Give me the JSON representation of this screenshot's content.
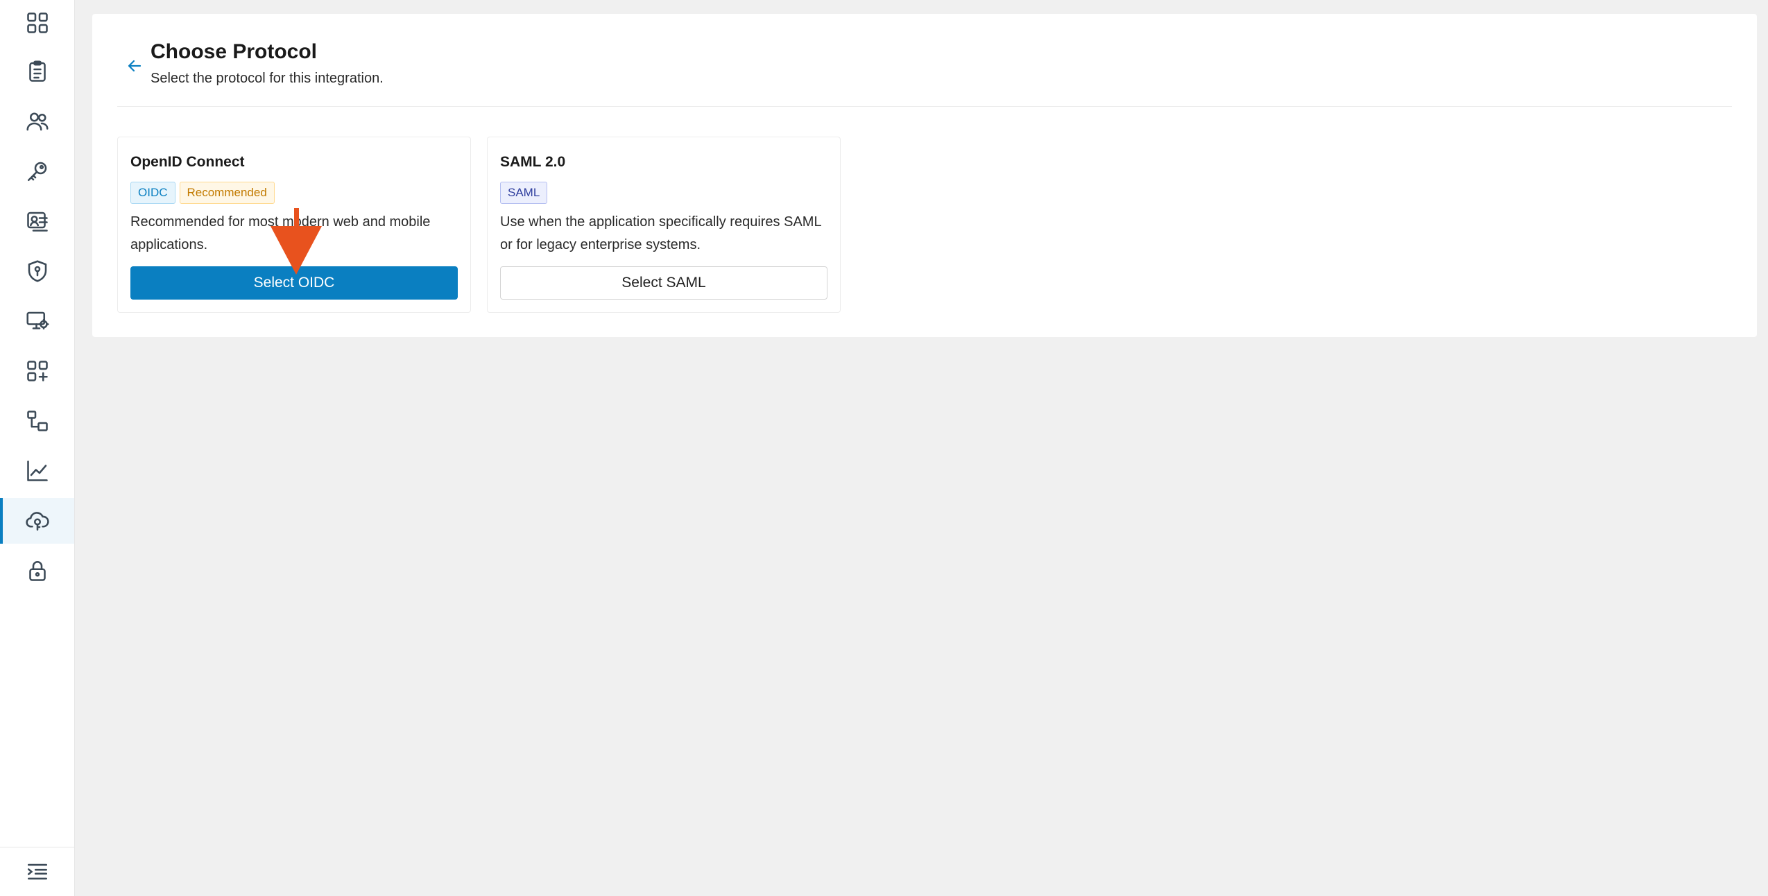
{
  "sidebar": {
    "items": [
      {
        "icon": "dashboard-grid-icon",
        "active": false
      },
      {
        "icon": "clipboard-list-icon",
        "active": false
      },
      {
        "icon": "users-icon",
        "active": false
      },
      {
        "icon": "key-icon",
        "active": false
      },
      {
        "icon": "user-card-icon",
        "active": false
      },
      {
        "icon": "shield-key-icon",
        "active": false
      },
      {
        "icon": "monitor-gear-icon",
        "active": false
      },
      {
        "icon": "add-apps-icon",
        "active": false
      },
      {
        "icon": "workflow-icon",
        "active": false
      },
      {
        "icon": "line-chart-icon",
        "active": false
      },
      {
        "icon": "cloud-key-icon",
        "active": true
      },
      {
        "icon": "lock-icon",
        "active": false
      }
    ],
    "footer_icon": "collapse-menu-icon"
  },
  "header": {
    "title": "Choose Protocol",
    "subtitle": "Select the protocol for this integration."
  },
  "cards": [
    {
      "title": "OpenID Connect",
      "tags": [
        "OIDC",
        "Recommended"
      ],
      "description": "Recommended for most modern web and mobile applications.",
      "button_label": "Select OIDC"
    },
    {
      "title": "SAML 2.0",
      "tags": [
        "SAML"
      ],
      "description": "Use when the application specifically requires SAML or for legacy enterprise systems.",
      "button_label": "Select SAML"
    }
  ],
  "colors": {
    "accent": "#0a7fc1",
    "annotation": "#e8521e",
    "recommended": "#c27a00",
    "saml": "#2f3e9e"
  }
}
